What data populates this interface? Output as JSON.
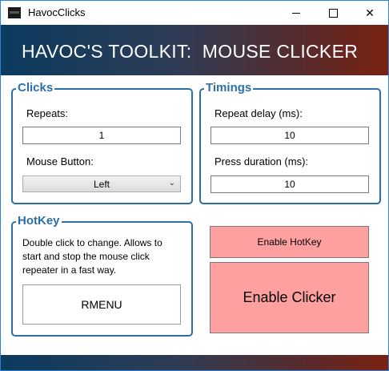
{
  "window": {
    "title": "HavocClicks",
    "controls": {
      "minimize": "minimize",
      "maximize": "maximize",
      "close": "✕"
    }
  },
  "header": {
    "title": "HAVOC'S TOOLKIT:  MOUSE CLICKER"
  },
  "clicks": {
    "label": "Clicks",
    "repeats_label": "Repeats:",
    "repeats_value": "1",
    "mouse_button_label": "Mouse Button:",
    "mouse_button_value": "Left"
  },
  "timings": {
    "label": "Timings",
    "repeat_delay_label": "Repeat delay (ms):",
    "repeat_delay_value": "10",
    "press_duration_label": "Press duration (ms):",
    "press_duration_value": "10"
  },
  "hotkey": {
    "label": "HotKey",
    "description": "Double click to change. Allows to start and stop the mouse click repeater in a fast way.",
    "value": "RMENU"
  },
  "buttons": {
    "enable_hotkey": "Enable HotKey",
    "enable_clicker": "Enable Clicker"
  },
  "colors": {
    "accent": "#2c6fa8",
    "button_bg": "#ffa0a0",
    "banner_left": "#0b3b5f",
    "banner_right": "#7a2210"
  }
}
